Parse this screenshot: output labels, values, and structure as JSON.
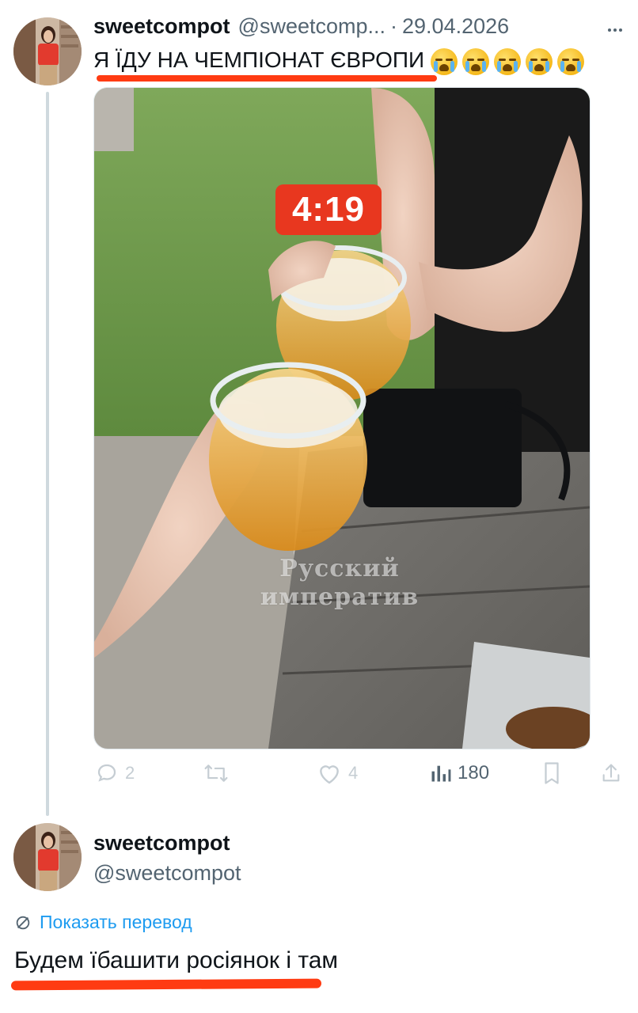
{
  "tweet1": {
    "display_name": "sweetcompot",
    "handle": "@sweetcomp...",
    "separator": "·",
    "date": "29.04.2026",
    "text": "Я ЇДУ НА ЧЕМПІОНАТ ЄВРОПИ",
    "emoji_count": 5,
    "emoji_name": "loudly-crying-face",
    "media": {
      "timer_badge": "4:19",
      "watermark_line1": "Русский",
      "watermark_line2": "императив"
    },
    "actions": {
      "replies": "2",
      "retweets": "",
      "likes": "4",
      "views": "180"
    }
  },
  "tweet2": {
    "display_name": "sweetcompot",
    "handle": "@sweetcompot",
    "translate_label": "Показать перевод",
    "text": "Будем їбашити росіянок і там"
  },
  "colors": {
    "accent_underline": "#ff3b12",
    "link_blue": "#1d9bf0",
    "timer_red": "#e8371f",
    "secondary_text": "#536471"
  }
}
